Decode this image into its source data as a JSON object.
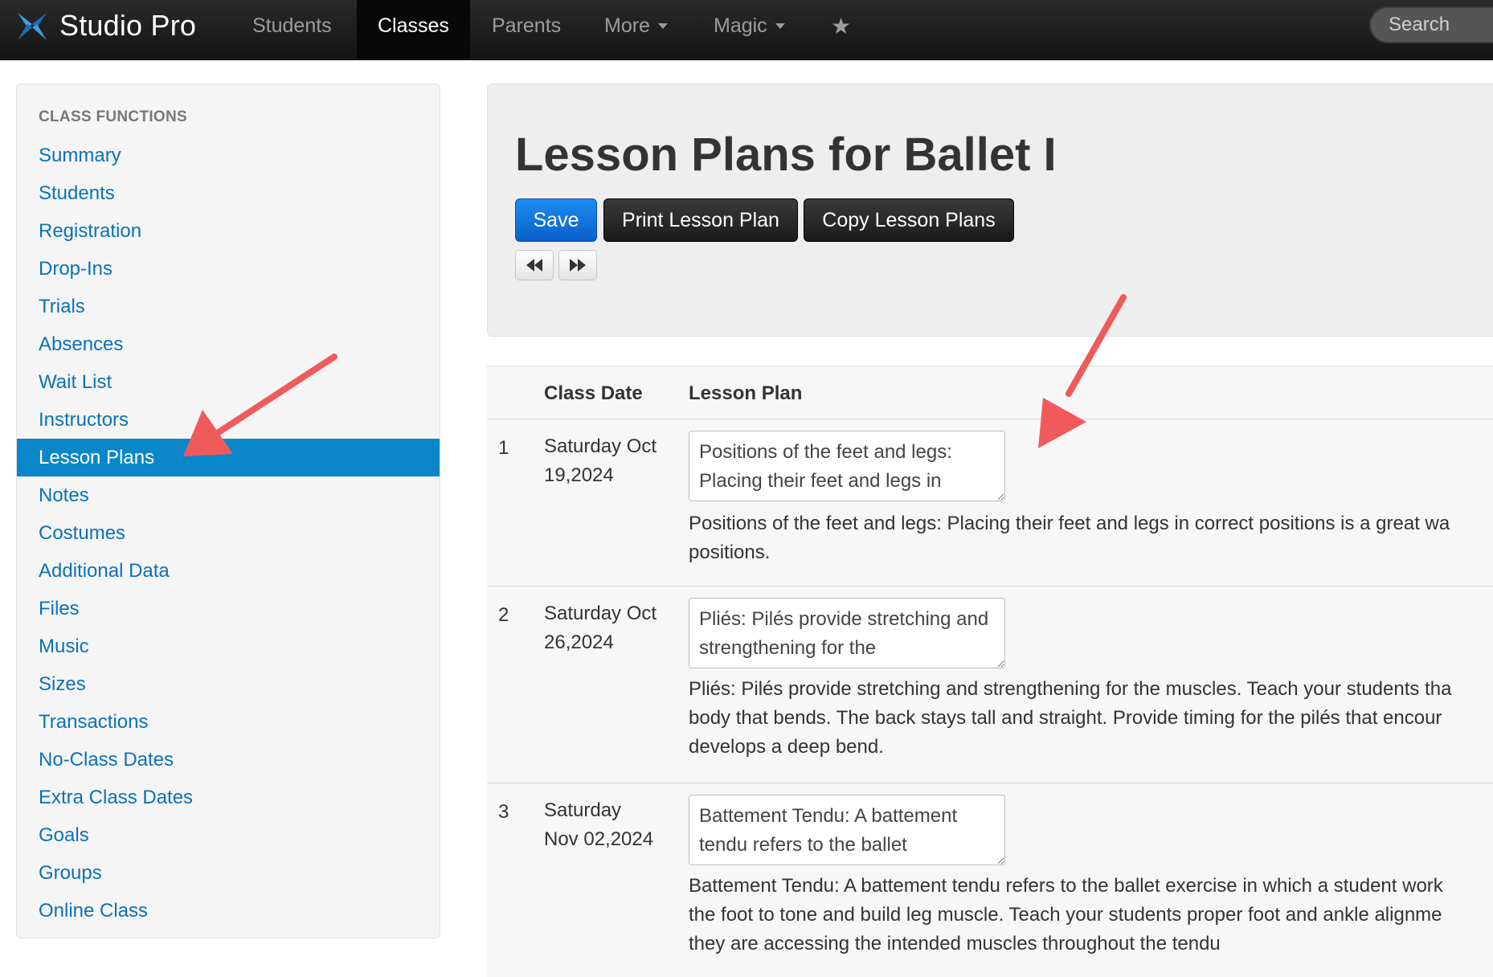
{
  "navbar": {
    "brand": "Studio Pro",
    "items": [
      {
        "label": "Students"
      },
      {
        "label": "Classes"
      },
      {
        "label": "Parents"
      },
      {
        "label": "More"
      },
      {
        "label": "Magic"
      }
    ],
    "search_placeholder": "Search"
  },
  "sidebar": {
    "header": "CLASS FUNCTIONS",
    "items": [
      {
        "label": "Summary"
      },
      {
        "label": "Students"
      },
      {
        "label": "Registration"
      },
      {
        "label": "Drop-Ins"
      },
      {
        "label": "Trials"
      },
      {
        "label": "Absences"
      },
      {
        "label": "Wait List"
      },
      {
        "label": "Instructors"
      },
      {
        "label": "Lesson Plans"
      },
      {
        "label": "Notes"
      },
      {
        "label": "Costumes"
      },
      {
        "label": "Additional Data"
      },
      {
        "label": "Files"
      },
      {
        "label": "Music"
      },
      {
        "label": "Sizes"
      },
      {
        "label": "Transactions"
      },
      {
        "label": "No-Class Dates"
      },
      {
        "label": "Extra Class Dates"
      },
      {
        "label": "Goals"
      },
      {
        "label": "Groups"
      },
      {
        "label": "Online Class"
      }
    ]
  },
  "main": {
    "title": "Lesson Plans for Ballet I",
    "save_label": "Save",
    "print_label": "Print Lesson Plan",
    "copy_label": "Copy Lesson Plans",
    "table": {
      "col_date": "Class Date",
      "col_plan": "Lesson Plan",
      "rows": [
        {
          "num": "1",
          "date_line1": "Saturday Oct",
          "date_line2": "19,2024",
          "input_value": "Positions of the feet and legs: Placing their feet and legs in",
          "text_line1": "Positions of the feet and legs: Placing their feet and legs in correct positions is a great wa",
          "text_line2": "positions.",
          "text_line3": ""
        },
        {
          "num": "2",
          "date_line1": "Saturday Oct",
          "date_line2": "26,2024",
          "input_value": "Pliés: Pilés provide stretching and strengthening for the",
          "text_line1": "Pliés: Pilés provide stretching and strengthening for the muscles. Teach your students tha",
          "text_line2": "body that bends. The back stays tall and straight. Provide timing for the pilés that encour",
          "text_line3": "develops a deep bend."
        },
        {
          "num": "3",
          "date_line1": "Saturday",
          "date_line2": "Nov 02,2024",
          "input_value": "Battement Tendu: A battement tendu refers to the ballet",
          "text_line1": "Battement Tendu: A battement tendu refers to the ballet exercise in which a student work",
          "text_line2": "the foot to tone and build leg muscle. Teach your students proper foot and ankle alignme",
          "text_line3": "they are accessing the intended muscles throughout the tendu"
        }
      ]
    }
  },
  "colors": {
    "navbar": "#1a1a1a",
    "link": "#0a72b8",
    "active_item": "#0a87c9",
    "save_button": "#0a6fdc",
    "annotation_arrow": "#f05a5a"
  }
}
